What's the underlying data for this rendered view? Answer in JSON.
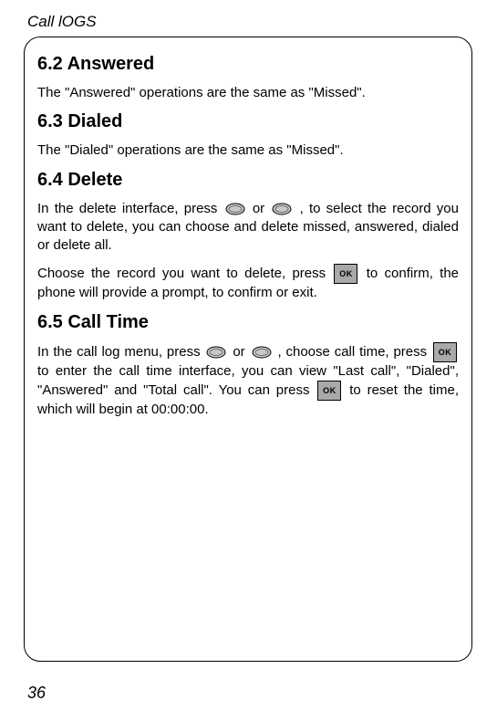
{
  "header": "Call lOGS",
  "page_number": "36",
  "sections": {
    "s62": {
      "heading": "6.2 Answered",
      "p1": "The \"Answered\" operations are the same as \"Missed\"."
    },
    "s63": {
      "heading": "6.3 Dialed",
      "p1": "The \"Dialed\" operations are the same as \"Missed\"."
    },
    "s64": {
      "heading": "6.4 Delete",
      "p1a": "In the delete interface, press",
      "p1b": " or",
      "p1c": ", to select the record you want to delete, you can choose and delete missed, answered, dialed or delete all.",
      "p2a": "Choose the record you want to delete, press ",
      "p2b": " to confirm, the phone will provide a prompt, to confirm or exit."
    },
    "s65": {
      "heading": "6.5 Call Time",
      "p1a": "In the call log menu, press",
      "p1b": " or",
      "p1c": ", choose call time, press",
      "p1d": " to enter the call time interface, you can view \"Last call\", \"Dialed\", \"Answered\" and \"Total call\". You can press ",
      "p1e": "to reset the time, which will begin at 00:00:00."
    }
  }
}
